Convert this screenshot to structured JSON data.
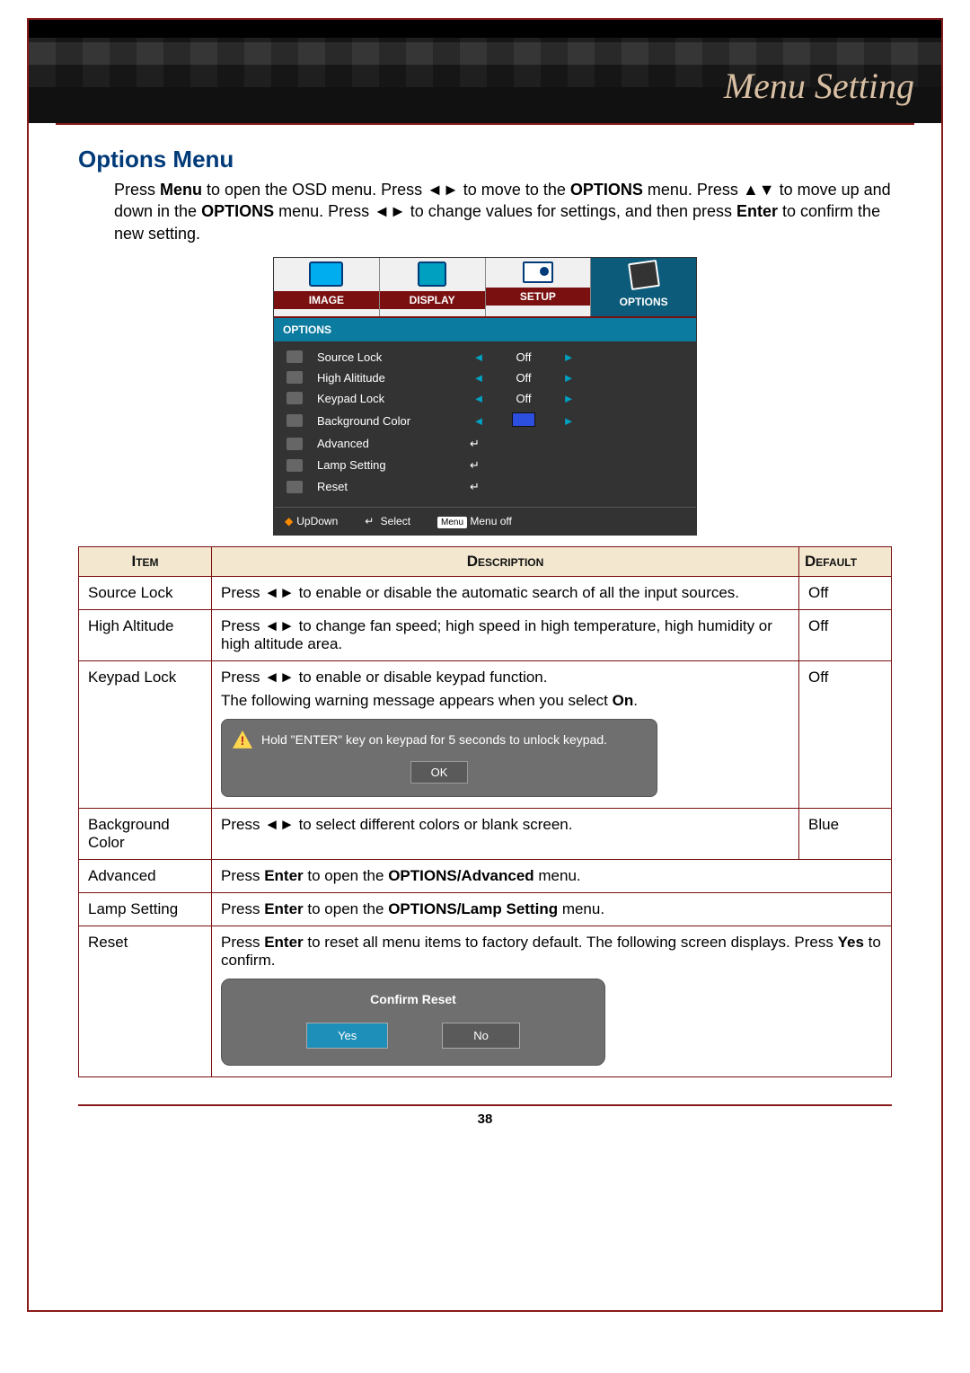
{
  "banner": {
    "title": "Menu Setting"
  },
  "section_heading": "Options Menu",
  "intro": {
    "s1a": "Press ",
    "s1b": "Menu",
    "s1c": " to open the OSD menu. Press ",
    "s1d": " to move to the ",
    "s1e": "OPTIONS",
    "s1f": " menu. Press ",
    "s1g": " to move up and down in the ",
    "s1h": "OPTIONS",
    "s1i": " menu. Press ",
    "s1j": " to change values for settings, and then press ",
    "s1k": "Enter",
    "s1l": " to confirm the new setting."
  },
  "glyphs": {
    "lr": "◄►",
    "ud": "▲▼",
    "enter": "↵"
  },
  "osd": {
    "tabs": [
      "IMAGE",
      "DISPLAY",
      "SETUP",
      "OPTIONS"
    ],
    "subhead": "OPTIONS",
    "rows": [
      {
        "label": "Source Lock",
        "type": "lr",
        "value": "Off"
      },
      {
        "label": "High Alititude",
        "type": "lr",
        "value": "Off"
      },
      {
        "label": "Keypad Lock",
        "type": "lr",
        "value": "Off"
      },
      {
        "label": "Background Color",
        "type": "color",
        "value": "blue"
      },
      {
        "label": "Advanced",
        "type": "enter"
      },
      {
        "label": "Lamp Setting",
        "type": "enter"
      },
      {
        "label": "Reset",
        "type": "enter"
      }
    ],
    "foot": {
      "updown": "UpDown",
      "select": "Select",
      "menu_key": "Menu",
      "menuoff": "Menu off"
    }
  },
  "table": {
    "headers": {
      "item": "Item",
      "desc": "Description",
      "def": "Default"
    },
    "rows": {
      "source_lock": {
        "item": "Source Lock",
        "desc_pre": "Press ",
        "desc_post": " to enable or disable the automatic search of all the input sources.",
        "def": "Off"
      },
      "high_alt": {
        "item": "High Altitude",
        "desc_pre": "Press ",
        "desc_post": " to change fan speed; high speed in high temperature, high humidity or high altitude area.",
        "def": "Off"
      },
      "keypad": {
        "item": "Keypad Lock",
        "line1_pre": "Press ",
        "line1_post": " to enable or disable keypad function.",
        "line2a": "The following warning message appears when you select ",
        "line2b": "On",
        "line2c": ".",
        "warn_text": "Hold \"ENTER\" key on keypad for 5 seconds to unlock keypad.",
        "ok": "OK",
        "def": "Off"
      },
      "bgcolor": {
        "item": "Background Color",
        "desc_pre": "Press ",
        "desc_post": " to select different colors or blank screen.",
        "def": "Blue"
      },
      "advanced": {
        "item": "Advanced",
        "desc_a": "Press ",
        "desc_b": "Enter",
        "desc_c": " to open the ",
        "desc_d": "OPTIONS/Advanced",
        "desc_e": " menu."
      },
      "lamp": {
        "item": "Lamp Setting",
        "desc_a": "Press ",
        "desc_b": "Enter",
        "desc_c": " to open the ",
        "desc_d": "OPTIONS/Lamp Setting",
        "desc_e": " menu."
      },
      "reset": {
        "item": "Reset",
        "line1a": "Press ",
        "line1b": "Enter",
        "line1c": " to reset all menu items to factory default. The following screen displays. Press ",
        "line1d": "Yes",
        "line1e": " to confirm.",
        "confirm_title": "Confirm Reset",
        "yes": "Yes",
        "no": "No"
      }
    }
  },
  "page_number": "38"
}
